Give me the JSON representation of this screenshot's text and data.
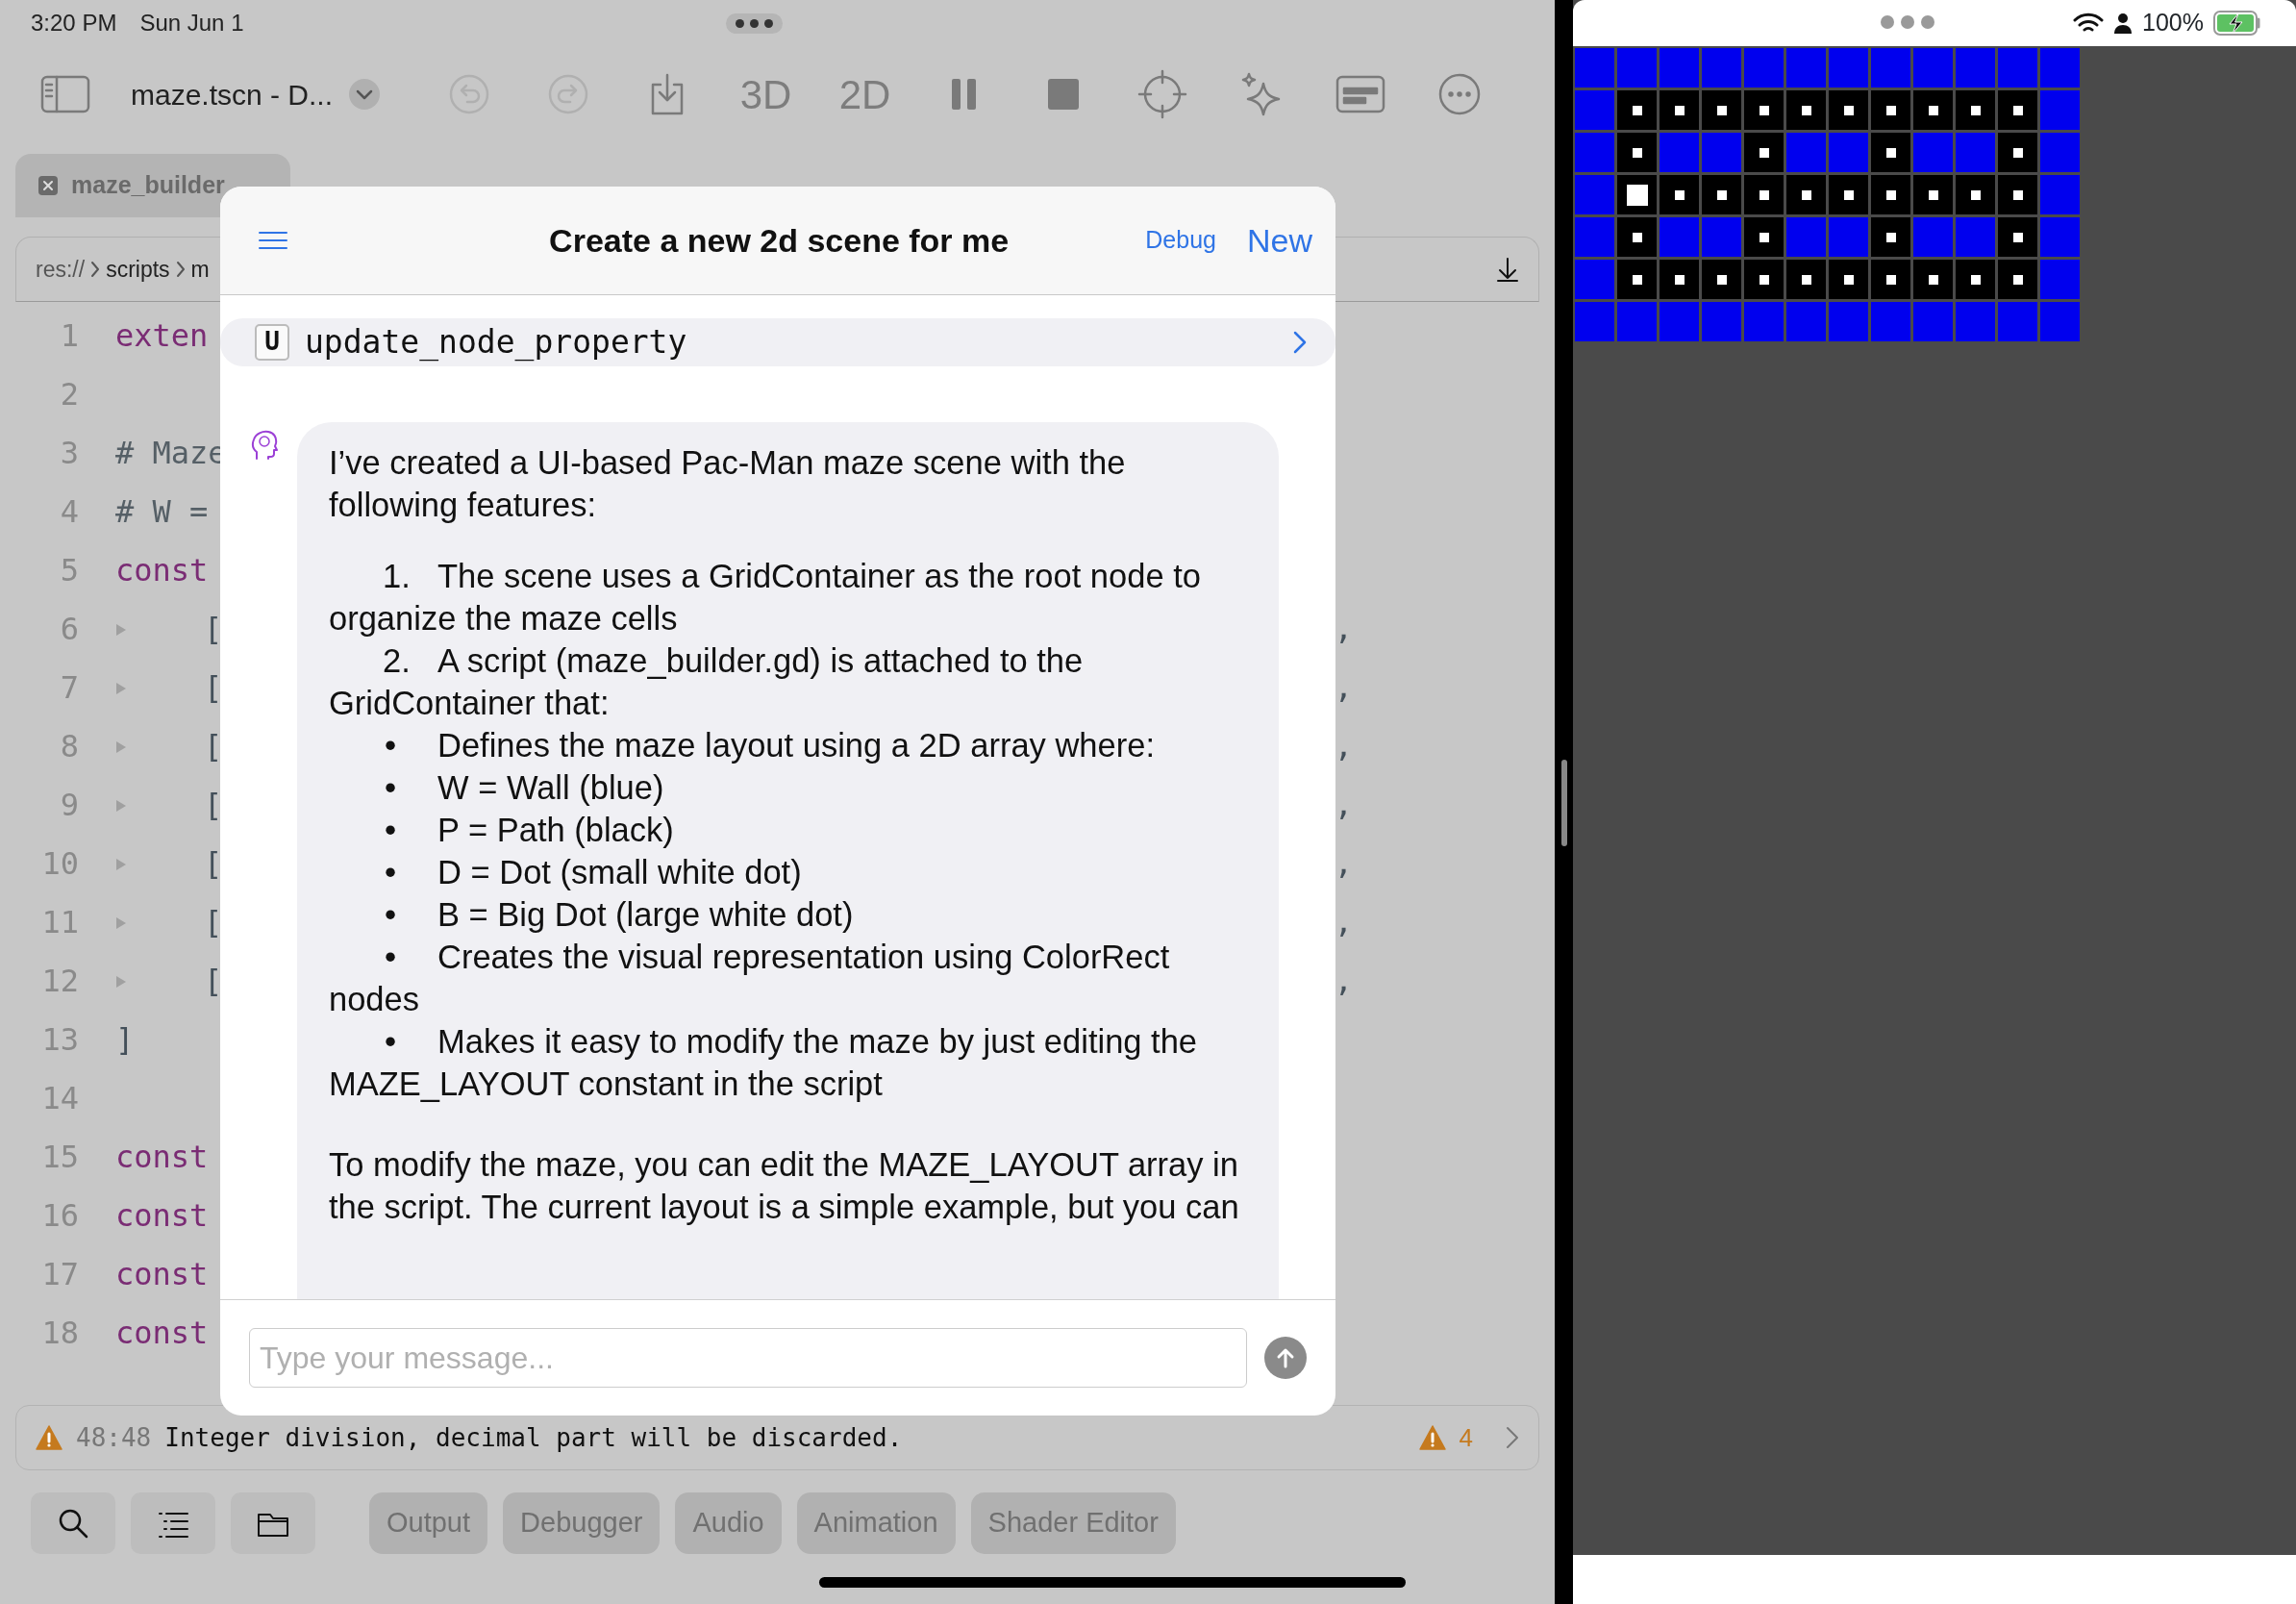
{
  "status_bar": {
    "time": "3:20 PM",
    "date": "Sun Jun 1",
    "battery": "100%"
  },
  "toolbar": {
    "scene_menu": "maze.tscn - D...",
    "undo_disabled": true,
    "redo_disabled": true,
    "view_3d": "3D",
    "view_2d": "2D"
  },
  "editor_tab": {
    "label": "maze_builder"
  },
  "breadcrumb": [
    "res://",
    "scripts",
    "m"
  ],
  "code_lines": [
    {
      "number": "1",
      "tokens": [
        {
          "kind": "keyword",
          "text": "exten"
        }
      ]
    },
    {
      "number": "2"
    },
    {
      "number": "3",
      "tokens": [
        {
          "kind": "comment",
          "text": "# Maze"
        }
      ]
    },
    {
      "number": "4",
      "tokens": [
        {
          "kind": "comment",
          "text": "# W ="
        }
      ]
    },
    {
      "number": "5",
      "tokens": [
        {
          "kind": "keyword",
          "text": "const"
        }
      ]
    },
    {
      "number": "6",
      "foldable": true,
      "tokens": [
        {
          "kind": "plain",
          "text": "["
        }
      ],
      "tail": ","
    },
    {
      "number": "7",
      "foldable": true,
      "tokens": [
        {
          "kind": "plain",
          "text": "["
        }
      ],
      "tail": ","
    },
    {
      "number": "8",
      "foldable": true,
      "tokens": [
        {
          "kind": "plain",
          "text": "["
        }
      ],
      "tail": ","
    },
    {
      "number": "9",
      "foldable": true,
      "tokens": [
        {
          "kind": "plain",
          "text": "["
        }
      ],
      "tail": ","
    },
    {
      "number": "10",
      "foldable": true,
      "tokens": [
        {
          "kind": "plain",
          "text": "["
        }
      ],
      "tail": ","
    },
    {
      "number": "11",
      "foldable": true,
      "tokens": [
        {
          "kind": "plain",
          "text": "["
        }
      ],
      "tail": ","
    },
    {
      "number": "12",
      "foldable": true,
      "tokens": [
        {
          "kind": "plain",
          "text": "["
        }
      ],
      "tail": ","
    },
    {
      "number": "13",
      "tokens": [
        {
          "kind": "plain",
          "text": "]"
        }
      ]
    },
    {
      "number": "14"
    },
    {
      "number": "15",
      "tokens": [
        {
          "kind": "keyword",
          "text": "const"
        }
      ]
    },
    {
      "number": "16",
      "tokens": [
        {
          "kind": "keyword",
          "text": "const"
        }
      ]
    },
    {
      "number": "17",
      "tokens": [
        {
          "kind": "keyword",
          "text": "const"
        }
      ]
    },
    {
      "number": "18",
      "tokens": [
        {
          "kind": "keyword",
          "text": "const"
        }
      ]
    }
  ],
  "chat": {
    "title": "Create a new 2d scene for me",
    "debug": "Debug",
    "new": "New",
    "tool_call": {
      "badge": "U",
      "name": "update_node_property"
    },
    "message": [
      {
        "kind": "paragraph",
        "text": "I’ve created a UI-based Pac-Man maze scene with the following features:"
      },
      {
        "kind": "numbered",
        "marker": "1.",
        "text": "The scene uses a GridContainer as the root node to organize the maze cells"
      },
      {
        "kind": "numbered",
        "marker": "2.",
        "text": "A script (maze_builder.gd) is attached to the GridContainer that:"
      },
      {
        "kind": "bullet",
        "marker": "•",
        "text": "Defines the maze layout using a 2D array where:"
      },
      {
        "kind": "bullet",
        "marker": "•",
        "text": "W = Wall (blue)"
      },
      {
        "kind": "bullet",
        "marker": "•",
        "text": "P = Path (black)"
      },
      {
        "kind": "bullet",
        "marker": "•",
        "text": "D = Dot (small white dot)"
      },
      {
        "kind": "bullet",
        "marker": "•",
        "text": "B = Big Dot (large white dot)"
      },
      {
        "kind": "bullet",
        "marker": "•",
        "text": "Creates the visual representation using ColorRect nodes"
      },
      {
        "kind": "bullet",
        "marker": "•",
        "text": "Makes it easy to modify the maze by just editing the MAZE_LAYOUT constant in the script"
      },
      {
        "kind": "paragraph",
        "text": "To modify the maze, you can edit the MAZE_LAYOUT array in the script. The current layout is a simple example, but you can"
      }
    ],
    "input": {
      "placeholder": "Type your message..."
    }
  },
  "problem": {
    "position": "48:48",
    "message": "Integer division, decimal part will be discarded.",
    "warning_count": "4"
  },
  "bottom_tabs": [
    {
      "label": "Output",
      "selected": false
    },
    {
      "label": "Debugger",
      "selected": false
    },
    {
      "label": "Audio",
      "selected": false
    },
    {
      "label": "Animation",
      "selected": false
    },
    {
      "label": "Shader Editor",
      "selected": false
    }
  ],
  "maze": [
    {
      "cells": [
        {
          "kind": "wall"
        },
        {
          "kind": "wall"
        },
        {
          "kind": "wall"
        },
        {
          "kind": "wall"
        },
        {
          "kind": "wall"
        },
        {
          "kind": "wall"
        },
        {
          "kind": "wall"
        },
        {
          "kind": "wall"
        },
        {
          "kind": "wall"
        },
        {
          "kind": "wall"
        },
        {
          "kind": "wall"
        },
        {
          "kind": "wall"
        }
      ]
    },
    {
      "cells": [
        {
          "kind": "wall"
        },
        {
          "kind": "dot"
        },
        {
          "kind": "dot"
        },
        {
          "kind": "dot"
        },
        {
          "kind": "dot"
        },
        {
          "kind": "dot"
        },
        {
          "kind": "dot"
        },
        {
          "kind": "dot"
        },
        {
          "kind": "dot"
        },
        {
          "kind": "dot"
        },
        {
          "kind": "dot"
        },
        {
          "kind": "wall"
        }
      ]
    },
    {
      "cells": [
        {
          "kind": "wall"
        },
        {
          "kind": "dot"
        },
        {
          "kind": "wall"
        },
        {
          "kind": "wall"
        },
        {
          "kind": "dot"
        },
        {
          "kind": "wall"
        },
        {
          "kind": "wall"
        },
        {
          "kind": "dot"
        },
        {
          "kind": "wall"
        },
        {
          "kind": "wall"
        },
        {
          "kind": "dot"
        },
        {
          "kind": "wall"
        }
      ]
    },
    {
      "cells": [
        {
          "kind": "wall"
        },
        {
          "kind": "bigdot"
        },
        {
          "kind": "dot"
        },
        {
          "kind": "dot"
        },
        {
          "kind": "dot"
        },
        {
          "kind": "dot"
        },
        {
          "kind": "dot"
        },
        {
          "kind": "dot"
        },
        {
          "kind": "dot"
        },
        {
          "kind": "dot"
        },
        {
          "kind": "dot"
        },
        {
          "kind": "wall"
        }
      ]
    },
    {
      "cells": [
        {
          "kind": "wall"
        },
        {
          "kind": "dot"
        },
        {
          "kind": "wall"
        },
        {
          "kind": "wall"
        },
        {
          "kind": "dot"
        },
        {
          "kind": "wall"
        },
        {
          "kind": "wall"
        },
        {
          "kind": "dot"
        },
        {
          "kind": "wall"
        },
        {
          "kind": "wall"
        },
        {
          "kind": "dot"
        },
        {
          "kind": "wall"
        }
      ]
    },
    {
      "cells": [
        {
          "kind": "wall"
        },
        {
          "kind": "dot"
        },
        {
          "kind": "dot"
        },
        {
          "kind": "dot"
        },
        {
          "kind": "dot"
        },
        {
          "kind": "dot"
        },
        {
          "kind": "dot"
        },
        {
          "kind": "dot"
        },
        {
          "kind": "dot"
        },
        {
          "kind": "dot"
        },
        {
          "kind": "dot"
        },
        {
          "kind": "wall"
        }
      ]
    },
    {
      "cells": [
        {
          "kind": "wall"
        },
        {
          "kind": "wall"
        },
        {
          "kind": "wall"
        },
        {
          "kind": "wall"
        },
        {
          "kind": "wall"
        },
        {
          "kind": "wall"
        },
        {
          "kind": "wall"
        },
        {
          "kind": "wall"
        },
        {
          "kind": "wall"
        },
        {
          "kind": "wall"
        },
        {
          "kind": "wall"
        },
        {
          "kind": "wall"
        }
      ]
    }
  ]
}
